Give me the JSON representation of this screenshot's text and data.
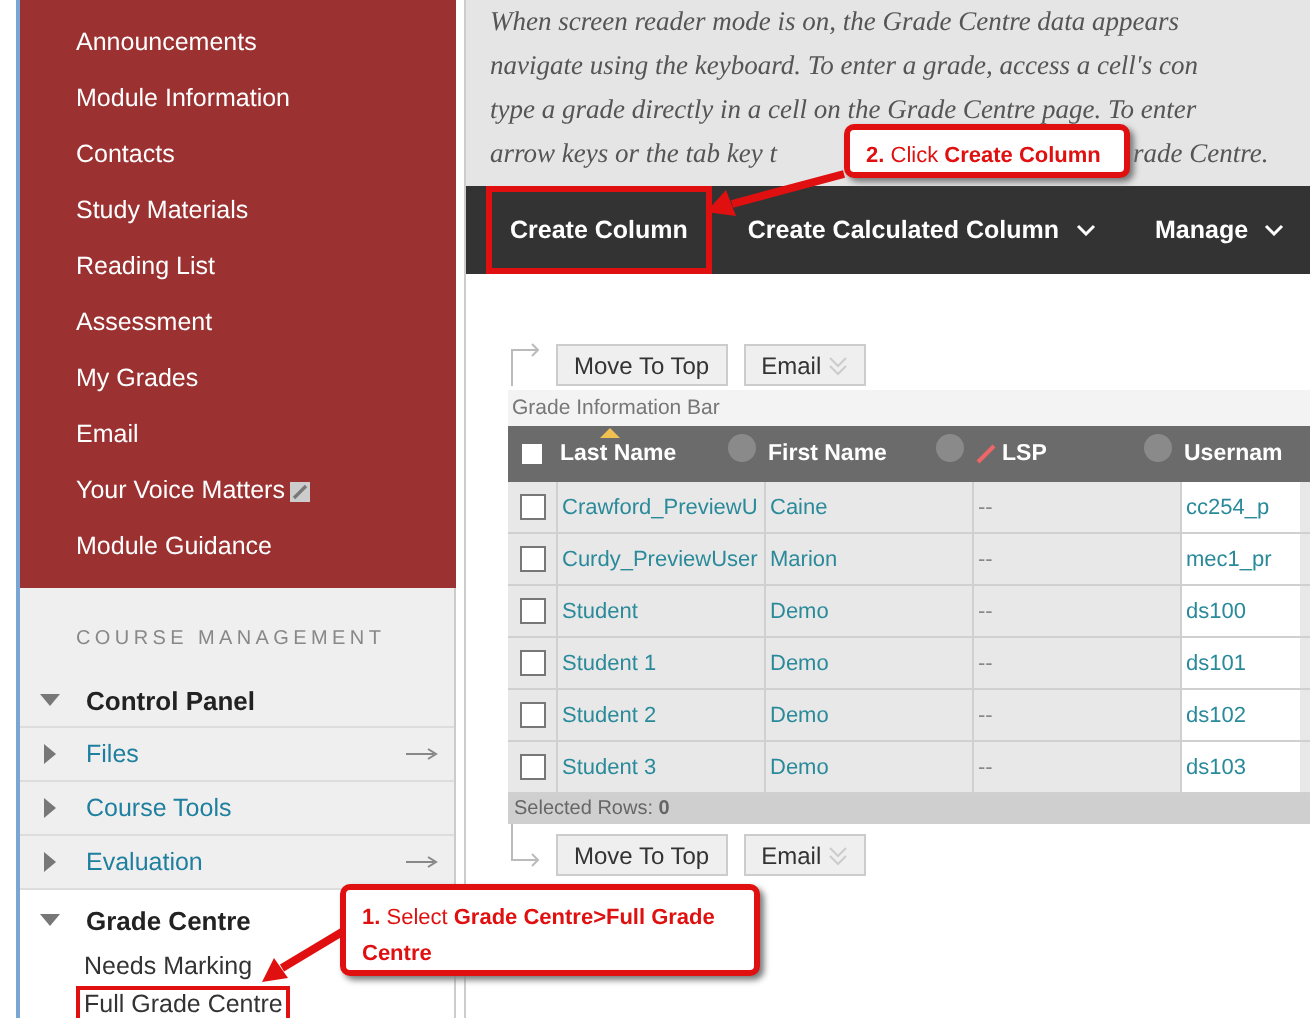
{
  "course_menu": [
    {
      "label": "Announcements",
      "badge_icon": false
    },
    {
      "label": "Module Information",
      "badge_icon": false
    },
    {
      "label": "Contacts",
      "badge_icon": false
    },
    {
      "label": "Study Materials",
      "badge_icon": false
    },
    {
      "label": "Reading List",
      "badge_icon": false
    },
    {
      "label": "Assessment",
      "badge_icon": false
    },
    {
      "label": "My Grades",
      "badge_icon": false
    },
    {
      "label": "Email",
      "badge_icon": false
    },
    {
      "label": "Your Voice Matters",
      "badge_icon": true
    },
    {
      "label": "Module Guidance",
      "badge_icon": false
    }
  ],
  "course_management": {
    "heading": "COURSE MANAGEMENT",
    "control_panel": {
      "label": "Control Panel",
      "expanded": true
    },
    "tools": [
      {
        "label": "Files",
        "kind": "link",
        "expanded": false,
        "has_arrow": true
      },
      {
        "label": "Course Tools",
        "kind": "link",
        "expanded": false,
        "has_arrow": false
      },
      {
        "label": "Evaluation",
        "kind": "link",
        "expanded": false,
        "has_arrow": true
      },
      {
        "label": "Grade Centre",
        "kind": "section",
        "expanded": true,
        "has_arrow": false,
        "children": [
          {
            "label": "Needs Marking",
            "annotated": false
          },
          {
            "label": "Full Grade Centre",
            "annotated": true
          }
        ]
      }
    ]
  },
  "instructions": [
    [
      "When screen reader mode is on, the Grade Centre data appears"
    ],
    [
      "navigate using the keyboard. To enter a grade, access a cell's con"
    ],
    [
      "type a grade directly in a cell on the Grade Centre page. To enter"
    ],
    [
      "arrow keys or the tab key t",
      "rade Centre."
    ]
  ],
  "toolbar": [
    {
      "label": "Create Column",
      "has_menu": false,
      "annotated": true
    },
    {
      "label": "Create Calculated Column",
      "has_menu": true,
      "annotated": false
    },
    {
      "label": "Manage",
      "has_menu": true,
      "annotated": false
    }
  ],
  "action_bar_top": [
    {
      "label": "Move To Top",
      "kind": "plain"
    },
    {
      "label": "Email",
      "kind": "menu"
    }
  ],
  "info_bar": "Grade Information Bar",
  "table": {
    "all_checked": false,
    "columns": [
      {
        "label": "Last Name",
        "sorted": true,
        "slash_icon": false
      },
      {
        "label": "First Name",
        "sorted": false,
        "slash_icon": false
      },
      {
        "label": "LSP",
        "sorted": false,
        "slash_icon": true
      },
      {
        "label": "Usernam",
        "sorted": false,
        "slash_icon": false
      }
    ],
    "rows": [
      {
        "checked": false,
        "cells": [
          "Crawford_PreviewU",
          "Caine",
          "--",
          "cc254_p"
        ]
      },
      {
        "checked": false,
        "cells": [
          "Curdy_PreviewUser",
          "Marion",
          "--",
          "mec1_pr"
        ]
      },
      {
        "checked": false,
        "cells": [
          "Student",
          "Demo",
          "--",
          "ds100"
        ]
      },
      {
        "checked": false,
        "cells": [
          "Student 1",
          "Demo",
          "--",
          "ds101"
        ]
      },
      {
        "checked": false,
        "cells": [
          "Student 2",
          "Demo",
          "--",
          "ds102"
        ]
      },
      {
        "checked": false,
        "cells": [
          "Student 3",
          "Demo",
          "--",
          "ds103"
        ]
      }
    ]
  },
  "selected_rows": "Selected Rows: **0**",
  "action_bar_bottom": [
    {
      "label": "Move To Top",
      "kind": "plain"
    },
    {
      "label": "Email",
      "kind": "menu"
    }
  ],
  "callouts": [
    {
      "text": "**1.** Select **Grade Centre>Full Grade Centre**"
    },
    {
      "text": "**2.** Click **Create Column**"
    }
  ]
}
